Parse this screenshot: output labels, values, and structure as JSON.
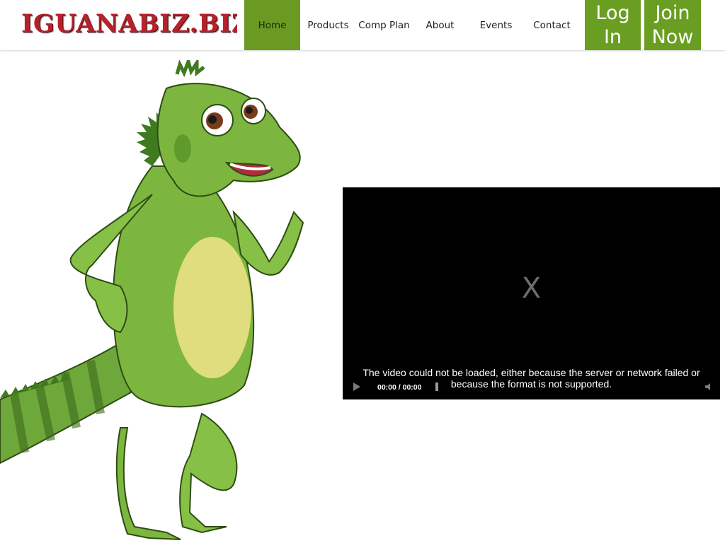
{
  "header": {
    "logo_text": "IGUANABIZ.BIZ",
    "nav": [
      {
        "label": "Home",
        "active": true
      },
      {
        "label": "Products"
      },
      {
        "label": "Comp Plan"
      },
      {
        "label": "About"
      },
      {
        "label": "Events"
      },
      {
        "label": "Contact"
      }
    ],
    "login_line1": "Log",
    "login_line2": "In",
    "join_line1": "Join",
    "join_line2": "Now"
  },
  "mascot": {
    "name": "iguana-mascot"
  },
  "video": {
    "error_glyph": "X",
    "error_message": "The video could not be loaded, either because the server or network failed or because the format is not supported.",
    "time_display": "00:00 / 00:00"
  },
  "colors": {
    "brand_green": "#6a9e22",
    "logo_red": "#b5222c",
    "video_bg": "#000000"
  }
}
